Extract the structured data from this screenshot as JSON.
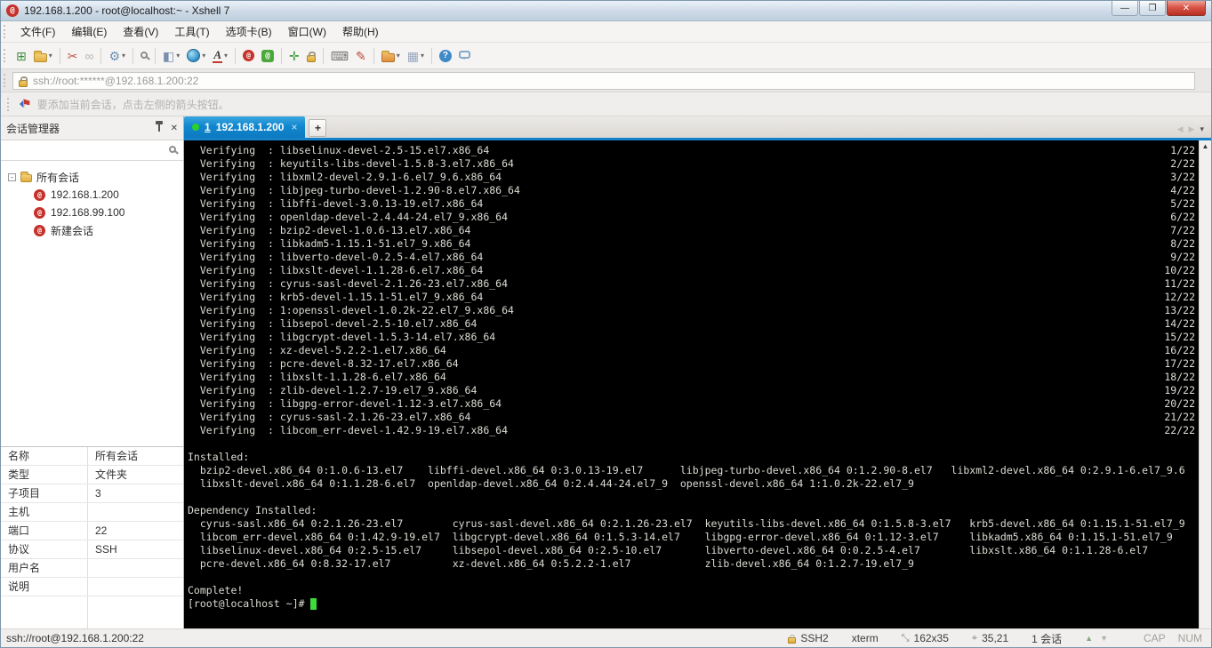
{
  "window": {
    "title": "192.168.1.200 - root@localhost:~ - Xshell 7"
  },
  "icons": {
    "minimize": "—",
    "restore": "❐",
    "close": "✕",
    "dropdown": "▾",
    "flag": "⚑",
    "panel_close": "✕",
    "expander": "-",
    "tab_close": "×",
    "new_tab": "+",
    "tab_left": "◀",
    "tab_right": "▶",
    "tab_drop": "▾",
    "scroll_up": "▲",
    "up_arrow": "▲",
    "down_arrow": "▼"
  },
  "menu": {
    "items": [
      "文件(F)",
      "编辑(E)",
      "查看(V)",
      "工具(T)",
      "选项卡(B)",
      "窗口(W)",
      "帮助(H)"
    ]
  },
  "toolbar": {
    "items": [
      {
        "name": "new-session-icon",
        "glyph": "⊞",
        "color": "#3e8e3e"
      },
      {
        "name": "open-folder-icon",
        "shape": "folder",
        "dropdown": true
      },
      {
        "sep": true
      },
      {
        "name": "disconnect-icon",
        "glyph": "✂",
        "color": "#c45348"
      },
      {
        "name": "reconnect-icon",
        "glyph": "∞",
        "color": "#b5b3b0"
      },
      {
        "sep": true
      },
      {
        "name": "session-properties-icon",
        "glyph": "⚙",
        "color": "#6b8fb5",
        "dropdown": true
      },
      {
        "sep": true
      },
      {
        "name": "find-icon",
        "shape": "mag"
      },
      {
        "sep": true
      },
      {
        "name": "color-scheme-icon",
        "glyph": "◧",
        "color": "#7a8fb0",
        "dropdown": true
      },
      {
        "name": "web-browser-icon",
        "shape": "globe",
        "dropdown": true
      },
      {
        "name": "font-icon",
        "shape": "fontA",
        "text": "A",
        "dropdown": true
      },
      {
        "sep": true
      },
      {
        "name": "xshell-icon",
        "shape": "snail",
        "text": "@"
      },
      {
        "name": "xftp-icon",
        "shape": "xftp",
        "text": "@"
      },
      {
        "sep": true
      },
      {
        "name": "fullscreen-icon",
        "glyph": "✛",
        "color": "#3e9e3e"
      },
      {
        "name": "lock-screen-icon",
        "shape": "lockic"
      },
      {
        "sep": true
      },
      {
        "name": "virtual-keyboard-icon",
        "glyph": "⌨",
        "color": "#777"
      },
      {
        "name": "highlight-pen-icon",
        "glyph": "✎",
        "color": "#c0473e"
      },
      {
        "sep": true
      },
      {
        "name": "file-transfer-icon",
        "shape": "folder orange",
        "dropdown": true
      },
      {
        "name": "tile-windows-icon",
        "glyph": "▦",
        "color": "#96a6be",
        "dropdown": true
      },
      {
        "sep": true
      },
      {
        "name": "help-icon",
        "shape": "help",
        "text": "?"
      },
      {
        "name": "feedback-icon",
        "shape": "bubble"
      }
    ]
  },
  "address_bar": {
    "value": "ssh://root:******@192.168.1.200:22"
  },
  "notice_bar": {
    "text": "要添加当前会话，点击左侧的箭头按钮。"
  },
  "session_panel": {
    "title": "会话管理器",
    "tree": {
      "root_label": "所有会话",
      "items": [
        {
          "label": "192.168.1.200"
        },
        {
          "label": "192.168.99.100"
        },
        {
          "label": "新建会话"
        }
      ]
    }
  },
  "properties": {
    "rows": [
      {
        "label": "名称",
        "value": "所有会话"
      },
      {
        "label": "类型",
        "value": "文件夹"
      },
      {
        "label": "子项目",
        "value": "3"
      },
      {
        "label": "主机",
        "value": ""
      },
      {
        "label": "端口",
        "value": "22"
      },
      {
        "label": "协议",
        "value": "SSH"
      },
      {
        "label": "用户名",
        "value": ""
      },
      {
        "label": "说明",
        "value": ""
      }
    ]
  },
  "tabs": {
    "active": {
      "index": "1",
      "label": "192.168.1.200"
    }
  },
  "terminal": {
    "colors": {
      "background": "#000000",
      "foreground": "#dcdcd4",
      "cursor": "#3cdc3c"
    },
    "lines": [
      {
        "l": "  Verifying  : libselinux-devel-2.5-15.el7.x86_64",
        "r": "1/22"
      },
      {
        "l": "  Verifying  : keyutils-libs-devel-1.5.8-3.el7.x86_64",
        "r": "2/22"
      },
      {
        "l": "  Verifying  : libxml2-devel-2.9.1-6.el7_9.6.x86_64",
        "r": "3/22"
      },
      {
        "l": "  Verifying  : libjpeg-turbo-devel-1.2.90-8.el7.x86_64",
        "r": "4/22"
      },
      {
        "l": "  Verifying  : libffi-devel-3.0.13-19.el7.x86_64",
        "r": "5/22"
      },
      {
        "l": "  Verifying  : openldap-devel-2.4.44-24.el7_9.x86_64",
        "r": "6/22"
      },
      {
        "l": "  Verifying  : bzip2-devel-1.0.6-13.el7.x86_64",
        "r": "7/22"
      },
      {
        "l": "  Verifying  : libkadm5-1.15.1-51.el7_9.x86_64",
        "r": "8/22"
      },
      {
        "l": "  Verifying  : libverto-devel-0.2.5-4.el7.x86_64",
        "r": "9/22"
      },
      {
        "l": "  Verifying  : libxslt-devel-1.1.28-6.el7.x86_64",
        "r": "10/22"
      },
      {
        "l": "  Verifying  : cyrus-sasl-devel-2.1.26-23.el7.x86_64",
        "r": "11/22"
      },
      {
        "l": "  Verifying  : krb5-devel-1.15.1-51.el7_9.x86_64",
        "r": "12/22"
      },
      {
        "l": "  Verifying  : 1:openssl-devel-1.0.2k-22.el7_9.x86_64",
        "r": "13/22"
      },
      {
        "l": "  Verifying  : libsepol-devel-2.5-10.el7.x86_64",
        "r": "14/22"
      },
      {
        "l": "  Verifying  : libgcrypt-devel-1.5.3-14.el7.x86_64",
        "r": "15/22"
      },
      {
        "l": "  Verifying  : xz-devel-5.2.2-1.el7.x86_64",
        "r": "16/22"
      },
      {
        "l": "  Verifying  : pcre-devel-8.32-17.el7.x86_64",
        "r": "17/22"
      },
      {
        "l": "  Verifying  : libxslt-1.1.28-6.el7.x86_64",
        "r": "18/22"
      },
      {
        "l": "  Verifying  : zlib-devel-1.2.7-19.el7_9.x86_64",
        "r": "19/22"
      },
      {
        "l": "  Verifying  : libgpg-error-devel-1.12-3.el7.x86_64",
        "r": "20/22"
      },
      {
        "l": "  Verifying  : cyrus-sasl-2.1.26-23.el7.x86_64",
        "r": "21/22"
      },
      {
        "l": "  Verifying  : libcom_err-devel-1.42.9-19.el7.x86_64",
        "r": "22/22"
      },
      {
        "l": ""
      },
      {
        "l": "Installed:"
      },
      {
        "l": "  bzip2-devel.x86_64 0:1.0.6-13.el7    libffi-devel.x86_64 0:3.0.13-19.el7      libjpeg-turbo-devel.x86_64 0:1.2.90-8.el7   libxml2-devel.x86_64 0:2.9.1-6.el7_9.6"
      },
      {
        "l": "  libxslt-devel.x86_64 0:1.1.28-6.el7  openldap-devel.x86_64 0:2.4.44-24.el7_9  openssl-devel.x86_64 1:1.0.2k-22.el7_9"
      },
      {
        "l": ""
      },
      {
        "l": "Dependency Installed:"
      },
      {
        "l": "  cyrus-sasl.x86_64 0:2.1.26-23.el7        cyrus-sasl-devel.x86_64 0:2.1.26-23.el7  keyutils-libs-devel.x86_64 0:1.5.8-3.el7   krb5-devel.x86_64 0:1.15.1-51.el7_9"
      },
      {
        "l": "  libcom_err-devel.x86_64 0:1.42.9-19.el7  libgcrypt-devel.x86_64 0:1.5.3-14.el7    libgpg-error-devel.x86_64 0:1.12-3.el7     libkadm5.x86_64 0:1.15.1-51.el7_9"
      },
      {
        "l": "  libselinux-devel.x86_64 0:2.5-15.el7     libsepol-devel.x86_64 0:2.5-10.el7       libverto-devel.x86_64 0:0.2.5-4.el7        libxslt.x86_64 0:1.1.28-6.el7"
      },
      {
        "l": "  pcre-devel.x86_64 0:8.32-17.el7          xz-devel.x86_64 0:5.2.2-1.el7            zlib-devel.x86_64 0:1.2.7-19.el7_9"
      },
      {
        "l": ""
      },
      {
        "l": "Complete!"
      },
      {
        "l": "[root@localhost ~]# ",
        "cursor": true
      }
    ]
  },
  "status_bar": {
    "left": "ssh://root@192.168.1.200:22",
    "items": [
      {
        "name": "status-protocol",
        "icon": "lock",
        "label": "SSH2"
      },
      {
        "name": "status-terminal-type",
        "label": "xterm"
      },
      {
        "name": "status-terminal-size",
        "icon": "resize",
        "glyph": "⤡",
        "label": "162x35"
      },
      {
        "name": "status-cursor-position",
        "icon": "pos",
        "glyph": "⌖",
        "label": "35,21"
      },
      {
        "name": "status-session-count",
        "label": "1 会话"
      }
    ],
    "indicators": [
      "CAP",
      "NUM"
    ]
  },
  "colors": {
    "accent_blue": "#1581c8",
    "tab_green_dot": "#2bd12b",
    "close_button_red": "#c03627",
    "snail_red": "#c5312b"
  }
}
